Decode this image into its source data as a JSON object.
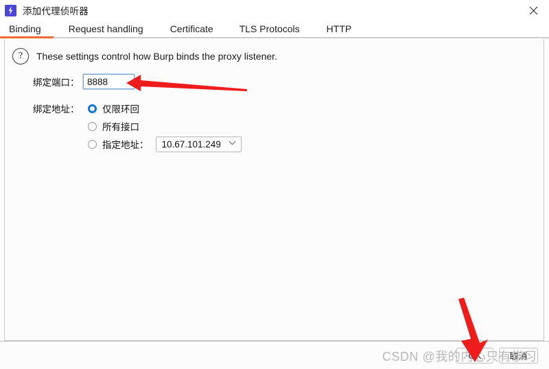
{
  "window": {
    "title": "添加代理侦听器",
    "app_icon": "burp-lightning-icon",
    "close_icon": "close-icon"
  },
  "tabs": [
    {
      "label": "Binding",
      "active": true
    },
    {
      "label": "Request handling",
      "active": false
    },
    {
      "label": "Certificate",
      "active": false
    },
    {
      "label": "TLS Protocols",
      "active": false
    },
    {
      "label": "HTTP",
      "active": false
    }
  ],
  "content": {
    "help_icon": "question-mark-icon",
    "info_text": "These settings control how Burp binds the proxy listener.",
    "bind_port": {
      "label": "绑定端口：",
      "value": "8888"
    },
    "bind_address": {
      "label": "绑定地址：",
      "options": [
        {
          "label": "仅限环回",
          "selected": true
        },
        {
          "label": "所有接口",
          "selected": false
        },
        {
          "label": "指定地址：",
          "selected": false
        }
      ],
      "specific_address_value": "10.67.101.249",
      "dropdown_icon": "chevron-down-icon"
    }
  },
  "footer": {
    "ok_label": "OK",
    "cancel_label": "取消"
  },
  "watermark": {
    "text": "CSDN @我的内心只有学习"
  },
  "annotations": {
    "port_arrow": "red-arrow-pointing-to-port-field",
    "ok_arrow": "red-arrow-pointing-to-ok-button"
  },
  "colors": {
    "accent_orange": "#ef6b34",
    "radio_blue": "#1277d4",
    "focus_blue": "#7aa8d6",
    "arrow_red": "#ef1c1c",
    "icon_purple": "#4a47d8"
  }
}
